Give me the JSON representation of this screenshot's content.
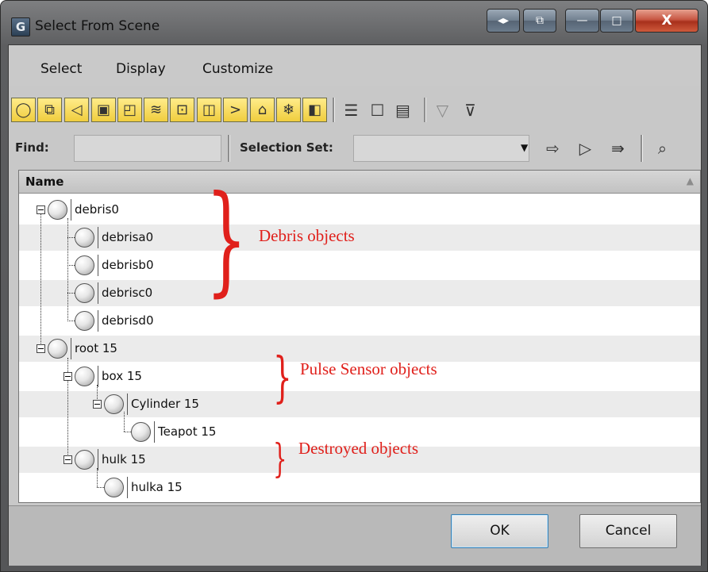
{
  "window": {
    "title": "Select From Scene",
    "app_icon_glyph": "G"
  },
  "titlebar_buttons": [
    {
      "name": "window-layout-button",
      "glyph": "◂▸"
    },
    {
      "name": "window-restore-alt-button",
      "glyph": "⧉"
    },
    {
      "name": "minimize-button",
      "glyph": "—"
    },
    {
      "name": "maximize-button",
      "glyph": "□"
    },
    {
      "name": "close-button",
      "glyph": "X"
    }
  ],
  "menu": [
    "Select",
    "Display",
    "Customize"
  ],
  "toolbar": {
    "filter_icons": [
      "geometry-icon",
      "shape-icon",
      "light-icon",
      "camera-icon",
      "helper-icon",
      "space-warp-icon",
      "group-icon",
      "xref-icon",
      "bone-icon",
      "container-icon",
      "frozen-icon",
      "hidden-icon"
    ],
    "list_icons": [
      "list-view-icon",
      "blank-view-icon",
      "detail-view-icon",
      "filter-icon",
      "filter-settings-icon"
    ]
  },
  "find": {
    "label": "Find:",
    "value": ""
  },
  "selection_set": {
    "label": "Selection Set:",
    "value": ""
  },
  "selection_icons": [
    "select-all-icon",
    "select-none-icon",
    "select-invert-icon",
    "find-case-icon"
  ],
  "list": {
    "header": "Name",
    "items": [
      {
        "label": "debris0"
      },
      {
        "label": "debrisa0"
      },
      {
        "label": "debrisb0"
      },
      {
        "label": "debrisc0"
      },
      {
        "label": "debrisd0"
      },
      {
        "label": "root 15"
      },
      {
        "label": "box 15"
      },
      {
        "label": "Cylinder 15"
      },
      {
        "label": "Teapot 15"
      },
      {
        "label": "hulk 15"
      },
      {
        "label": "hulka 15"
      }
    ]
  },
  "annotations": {
    "debris": "Debris objects",
    "pulse": "Pulse Sensor objects",
    "destroyed": "Destroyed objects",
    "color": "#e0201b"
  },
  "buttons": {
    "ok": "OK",
    "cancel": "Cancel"
  }
}
